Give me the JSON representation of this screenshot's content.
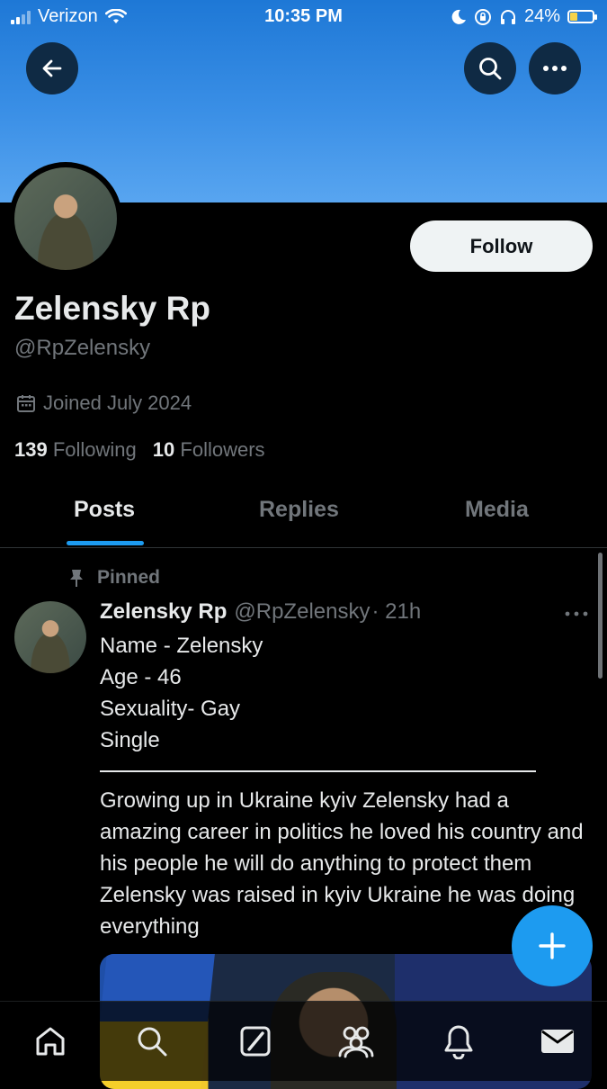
{
  "status_bar": {
    "carrier": "Verizon",
    "time": "10:35 PM",
    "battery": "24%"
  },
  "profile": {
    "display_name": "Zelensky Rp",
    "handle": "@RpZelensky",
    "joined": "Joined July 2024",
    "following_count": "139",
    "following_label": "Following",
    "followers_count": "10",
    "followers_label": "Followers",
    "follow_button": "Follow"
  },
  "tabs": [
    {
      "label": "Posts",
      "active": true
    },
    {
      "label": "Replies",
      "active": false
    },
    {
      "label": "Media",
      "active": false
    }
  ],
  "pinned_post": {
    "pinned_label": "Pinned",
    "author_name": "Zelensky Rp",
    "author_handle": "@RpZelensky",
    "time": "· 21h",
    "lines": [
      "Name - Zelensky",
      "Age - 46",
      "Sexuality- Gay",
      "Single"
    ],
    "body": "Growing up in Ukraine kyiv Zelensky had a amazing career in politics he loved his country and his people he will do anything to protect them Zelensky was raised in kyiv Ukraine he was doing everything"
  },
  "icons": {
    "back": "arrow-left-icon",
    "search": "search-icon",
    "more": "more-icon",
    "compose": "plus-icon",
    "nav": [
      "home-icon",
      "search-icon",
      "grok-icon",
      "communities-icon",
      "notifications-icon",
      "messages-icon"
    ]
  },
  "colors": {
    "accent": "#1d9bf0",
    "banner": "#3a8fe6",
    "muted_text": "#71767b",
    "text": "#e7e9ea",
    "background": "#000000"
  }
}
